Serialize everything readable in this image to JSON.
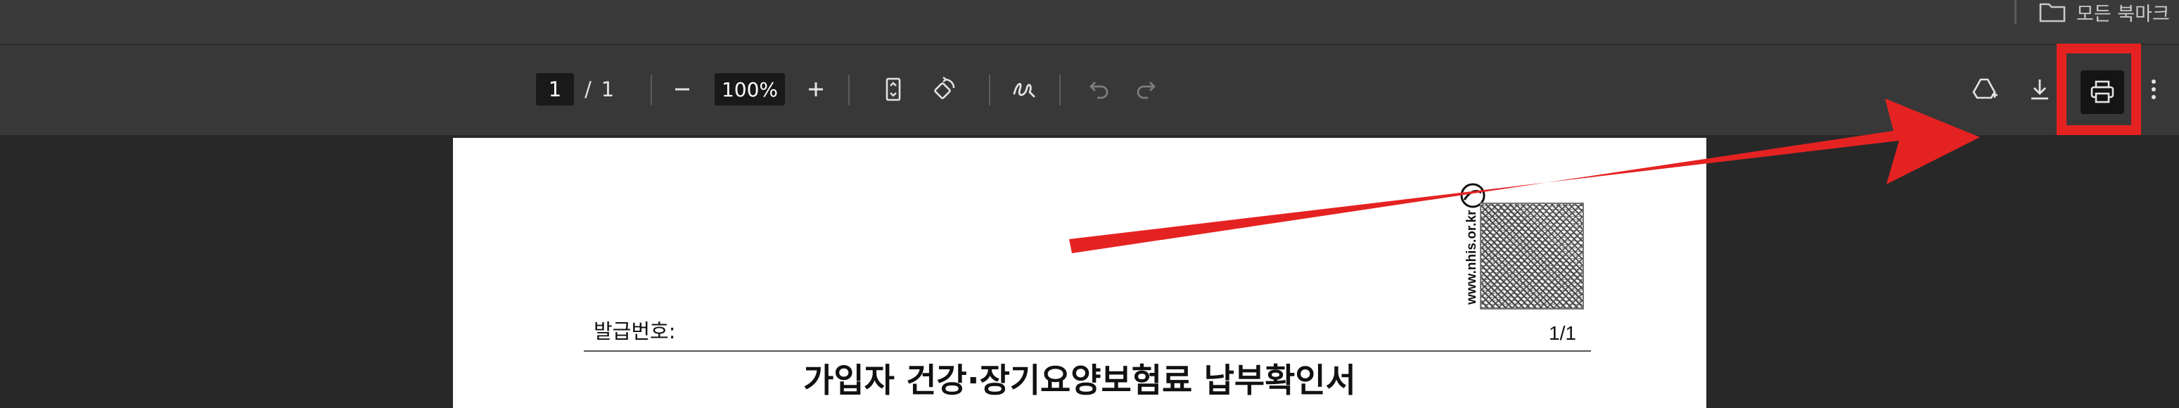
{
  "bookmarks_bar": {
    "folder_label": "모든 북마크"
  },
  "toolbar": {
    "current_page": "1",
    "page_separator": "/",
    "total_pages": "1",
    "zoom_level": "100%"
  },
  "icons": {
    "zoom_out": "minus-icon",
    "zoom_in": "plus-icon",
    "fit_page": "fit-to-page-icon",
    "rotate": "rotate-icon",
    "draw": "draw-icon",
    "undo": "undo-icon",
    "redo": "redo-icon",
    "drive": "drive-add-icon",
    "download": "download-icon",
    "print": "print-icon",
    "more": "more-vertical-icon"
  },
  "document": {
    "website": "www.nhis.or.kr",
    "issue_number_label": "발급번호:",
    "page_count": "1/1",
    "title": "가입자 건강·장기요양보험료 납부확인서"
  },
  "colors": {
    "annotation_red": "#e52222",
    "toolbar_bg": "#383838",
    "viewer_bg": "#282828"
  }
}
